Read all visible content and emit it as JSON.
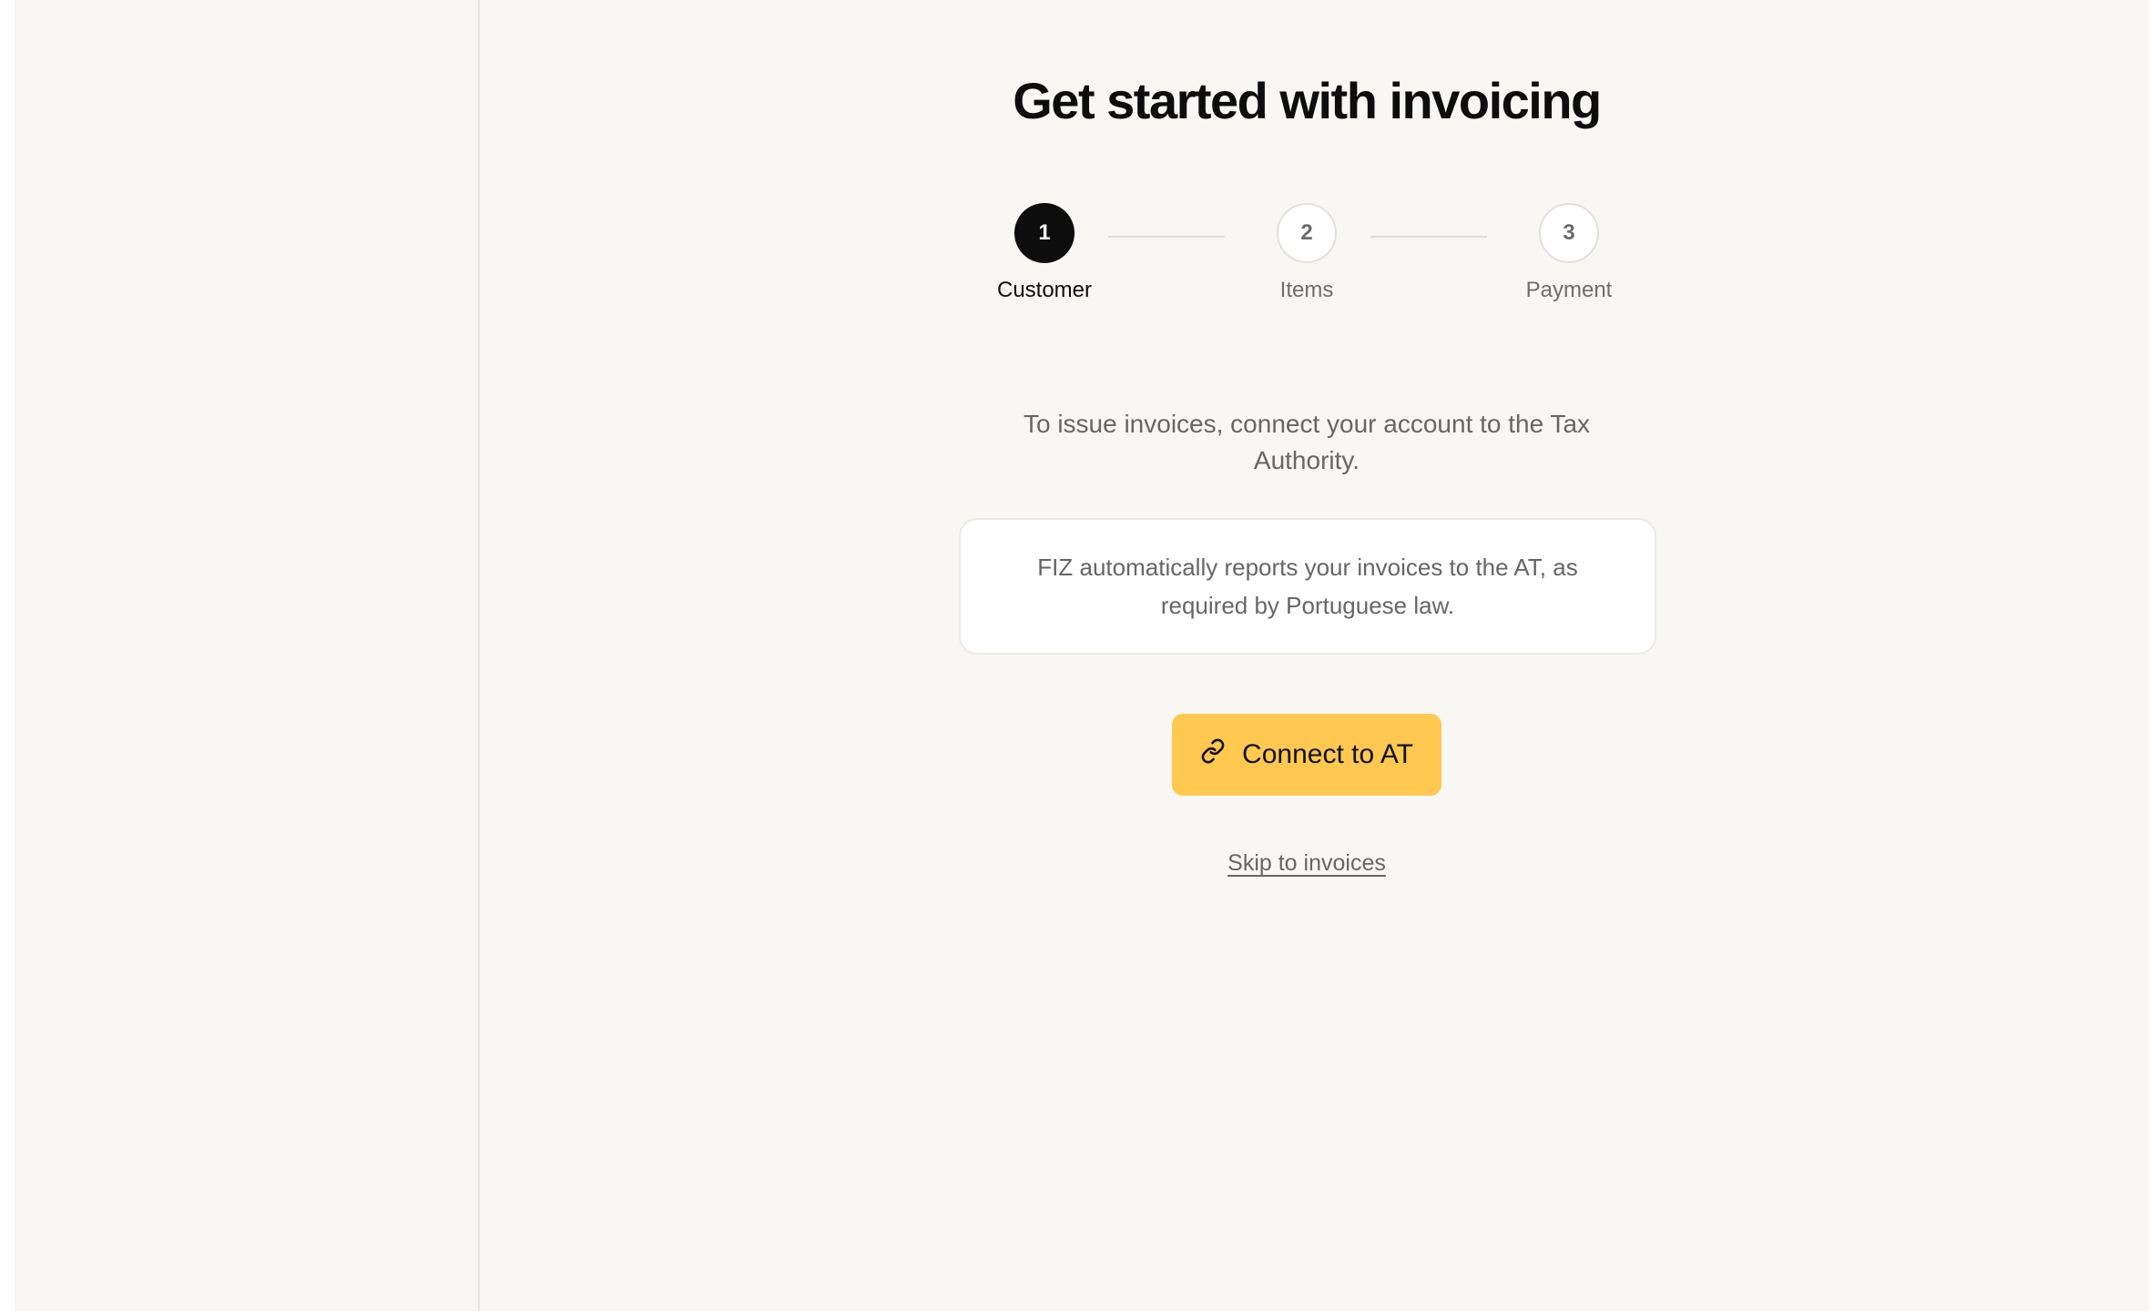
{
  "onboarding": {
    "title": "Get started with invoicing",
    "steps": [
      {
        "number": "1",
        "label": "Customer",
        "state": "active"
      },
      {
        "number": "2",
        "label": "Items",
        "state": "pending"
      },
      {
        "number": "3",
        "label": "Payment",
        "state": "pending"
      }
    ],
    "intro_text": "To issue invoices, connect your account to the Tax Authority.",
    "info_text": "FIZ automatically reports your invoices to the AT, as required by Portuguese law.",
    "connect_button": {
      "label": "Connect to AT",
      "icon": "link-icon"
    },
    "skip_link": "Skip to invoices"
  },
  "colors": {
    "background": "#f8f7f4",
    "accent": "#ffc850",
    "active_step": "#0d0d0d",
    "muted_text": "#666666"
  }
}
